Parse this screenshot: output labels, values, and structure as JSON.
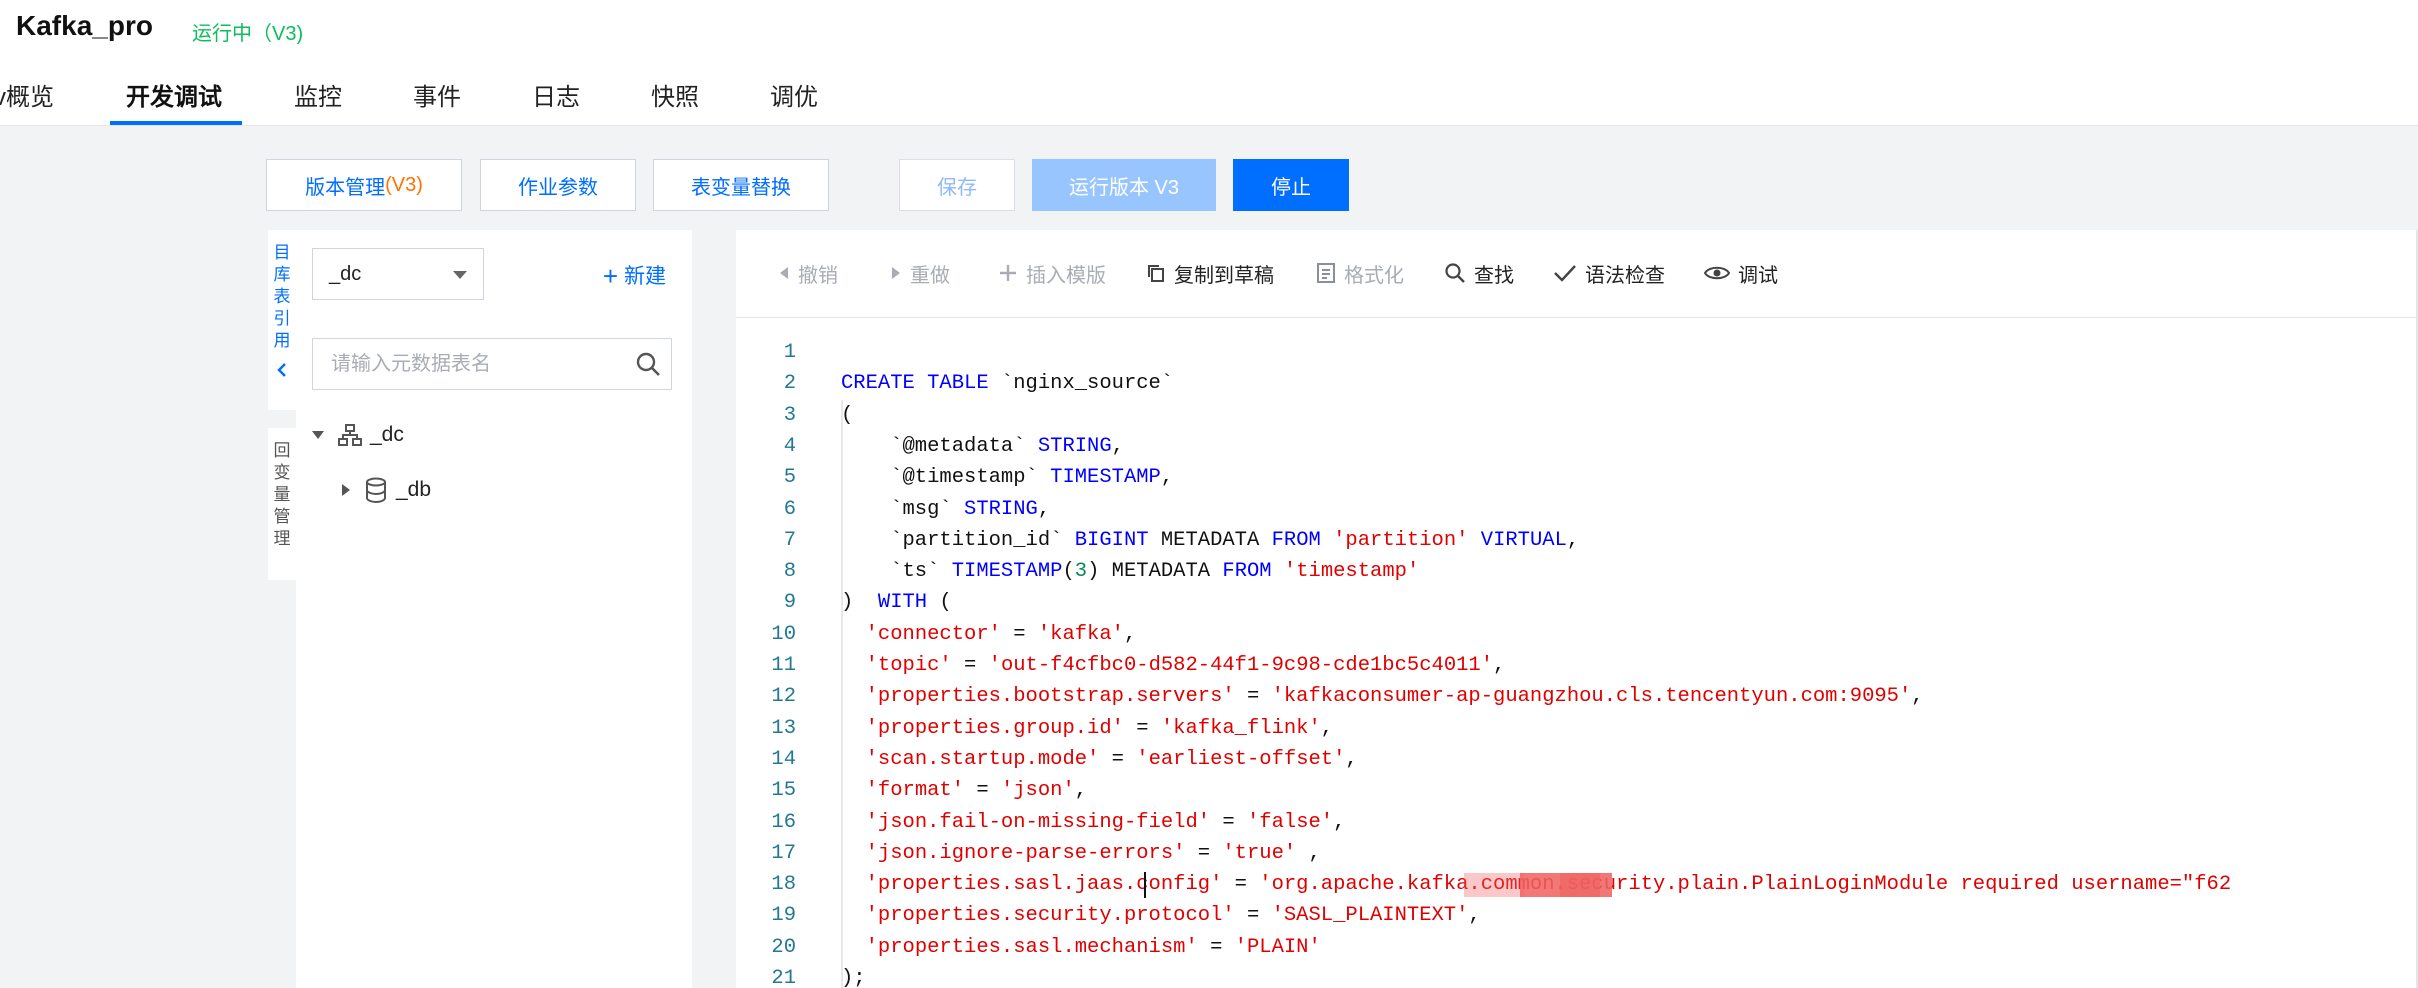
{
  "app": {
    "title": "Kafka_pro",
    "status": "运行中（V3)"
  },
  "tabs": [
    {
      "label": "v概览"
    },
    {
      "label": "开发调试"
    },
    {
      "label": "监控"
    },
    {
      "label": "事件"
    },
    {
      "label": "日志"
    },
    {
      "label": "快照"
    },
    {
      "label": "调优"
    }
  ],
  "actions": {
    "version_mgmt": "版本管理 ",
    "version_mgmt_tag": "(V3)",
    "job_params": "作业参数",
    "table_var_replace": "表变量替换",
    "save": "保存",
    "run_version": "运行版本 V3",
    "stop": "停止"
  },
  "side_strip": {
    "segment1": [
      "目",
      "库",
      "表",
      "引",
      "用"
    ],
    "segment2": [
      "回",
      "变",
      "量",
      "管",
      "理"
    ]
  },
  "meta_panel": {
    "db_select_value": "_dc",
    "new_label": "新建",
    "search_placeholder": "请输入元数据表名",
    "tree": [
      {
        "label": "_dc"
      },
      {
        "label": "_db"
      }
    ]
  },
  "toolbar": {
    "undo": "撤销",
    "redo": "重做",
    "insert_template": "插入模版",
    "copy_to_draft": "复制到草稿",
    "format": "格式化",
    "find": "查找",
    "syntax_check": "语法检查",
    "debug": "调试"
  },
  "code_lines": [
    {
      "n": "1",
      "parts": []
    },
    {
      "n": "2",
      "parts": [
        [
          "kw",
          "CREATE TABLE "
        ],
        [
          "t",
          "`nginx_source`"
        ]
      ]
    },
    {
      "n": "3",
      "parts": [
        [
          "t",
          "("
        ]
      ]
    },
    {
      "n": "4",
      "parts": [
        [
          "t",
          "    `@metadata` "
        ],
        [
          "kw",
          "STRING"
        ],
        [
          "t",
          ","
        ]
      ]
    },
    {
      "n": "5",
      "parts": [
        [
          "t",
          "    `@timestamp` "
        ],
        [
          "kw",
          "TIMESTAMP"
        ],
        [
          "t",
          ","
        ]
      ]
    },
    {
      "n": "6",
      "parts": [
        [
          "t",
          "    `msg` "
        ],
        [
          "kw",
          "STRING"
        ],
        [
          "t",
          ","
        ]
      ]
    },
    {
      "n": "7",
      "parts": [
        [
          "t",
          "    `partition_id` "
        ],
        [
          "kw",
          "BIGINT"
        ],
        [
          "t",
          " METADATA "
        ],
        [
          "kw",
          "FROM"
        ],
        [
          "t",
          " "
        ],
        [
          "str",
          "'partition'"
        ],
        [
          "t",
          " "
        ],
        [
          "kw",
          "VIRTUAL"
        ],
        [
          "t",
          ","
        ]
      ]
    },
    {
      "n": "8",
      "parts": [
        [
          "t",
          "    `ts` "
        ],
        [
          "kw",
          "TIMESTAMP"
        ],
        [
          "t",
          "("
        ],
        [
          "num",
          "3"
        ],
        [
          "t",
          ") METADATA "
        ],
        [
          "kw",
          "FROM"
        ],
        [
          "t",
          " "
        ],
        [
          "str",
          "'timestamp'"
        ]
      ]
    },
    {
      "n": "9",
      "parts": [
        [
          "t",
          ")  "
        ],
        [
          "kw",
          "WITH"
        ],
        [
          "t",
          " ("
        ]
      ]
    },
    {
      "n": "10",
      "parts": [
        [
          "t",
          "  "
        ],
        [
          "str",
          "'connector'"
        ],
        [
          "t",
          " = "
        ],
        [
          "str",
          "'kafka'"
        ],
        [
          "t",
          ","
        ]
      ]
    },
    {
      "n": "11",
      "parts": [
        [
          "t",
          "  "
        ],
        [
          "str",
          "'topic'"
        ],
        [
          "t",
          " = "
        ],
        [
          "str",
          "'out-f4cfbc0-d582-44f1-9c98-cde1bc5c4011'"
        ],
        [
          "t",
          ","
        ]
      ]
    },
    {
      "n": "12",
      "parts": [
        [
          "t",
          "  "
        ],
        [
          "str",
          "'properties.bootstrap.servers'"
        ],
        [
          "t",
          " = "
        ],
        [
          "str",
          "'kafkaconsumer-ap-guangzhou.cls.tencentyun.com:9095'"
        ],
        [
          "t",
          ","
        ]
      ]
    },
    {
      "n": "13",
      "parts": [
        [
          "t",
          "  "
        ],
        [
          "str",
          "'properties.group.id'"
        ],
        [
          "t",
          " = "
        ],
        [
          "str",
          "'kafka_flink'"
        ],
        [
          "t",
          ","
        ]
      ]
    },
    {
      "n": "14",
      "parts": [
        [
          "t",
          "  "
        ],
        [
          "str",
          "'scan.startup.mode'"
        ],
        [
          "t",
          " = "
        ],
        [
          "str",
          "'earliest-offset'"
        ],
        [
          "t",
          ","
        ]
      ]
    },
    {
      "n": "15",
      "parts": [
        [
          "t",
          "  "
        ],
        [
          "str",
          "'format'"
        ],
        [
          "t",
          " = "
        ],
        [
          "str",
          "'json'"
        ],
        [
          "t",
          ","
        ]
      ]
    },
    {
      "n": "16",
      "parts": [
        [
          "t",
          "  "
        ],
        [
          "str",
          "'json.fail-on-missing-field'"
        ],
        [
          "t",
          " = "
        ],
        [
          "str",
          "'false'"
        ],
        [
          "t",
          ","
        ]
      ]
    },
    {
      "n": "17",
      "parts": [
        [
          "t",
          "  "
        ],
        [
          "str",
          "'json.ignore-parse-errors'"
        ],
        [
          "t",
          " = "
        ],
        [
          "str",
          "'true'"
        ],
        [
          "t",
          " ,"
        ]
      ]
    },
    {
      "n": "18",
      "parts": [
        [
          "t",
          "  "
        ],
        [
          "str",
          "'properties.sasl.jaas.config'"
        ],
        [
          "t",
          " = "
        ],
        [
          "str",
          "'org.apache.kafka.common.security.plain.PlainLoginModule required username=\"f62"
        ]
      ]
    },
    {
      "n": "19",
      "parts": [
        [
          "t",
          "  "
        ],
        [
          "str",
          "'properties.security.protocol'"
        ],
        [
          "t",
          " = "
        ],
        [
          "str",
          "'SASL_PLAINTEXT'"
        ],
        [
          "t",
          ","
        ]
      ]
    },
    {
      "n": "20",
      "parts": [
        [
          "t",
          "  "
        ],
        [
          "str",
          "'properties.sasl.mechanism'"
        ],
        [
          "t",
          " = "
        ],
        [
          "str",
          "'PLAIN'"
        ]
      ]
    },
    {
      "n": "21",
      "parts": [
        [
          "t",
          ");"
        ]
      ]
    }
  ],
  "colors": {
    "accent": "#006eff",
    "status_green": "#0abf5b",
    "tag_orange": "#ff7200",
    "keyword_blue": "#0000ff",
    "string_red": "#e00000"
  }
}
